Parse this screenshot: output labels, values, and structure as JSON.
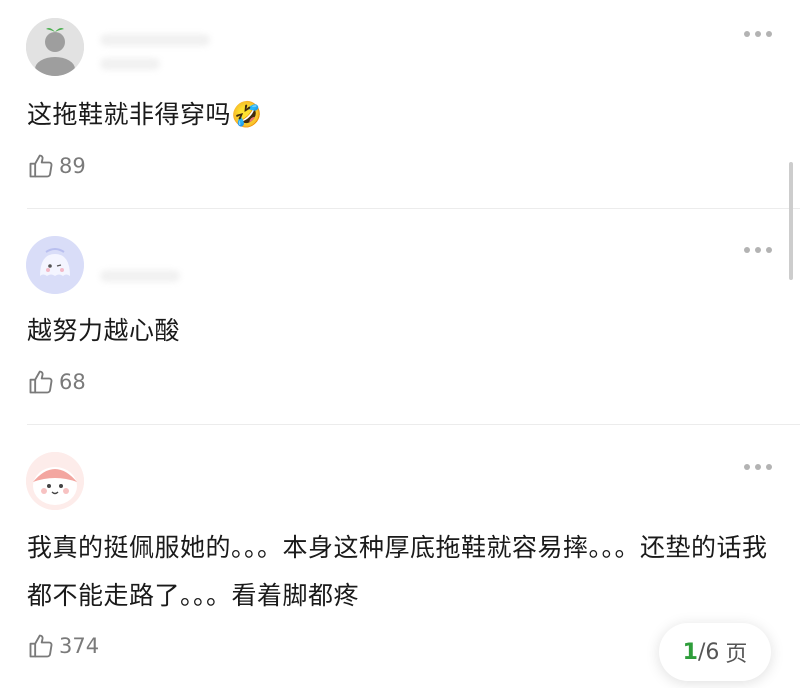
{
  "comments": [
    {
      "text": "这拖鞋就非得穿吗",
      "emoji": "🤣",
      "likes": "89"
    },
    {
      "text": "越努力越心酸",
      "likes": "68"
    },
    {
      "text": "我真的挺佩服她的。。。本身这种厚底拖鞋就容易摔。。。还垫的话我都不能走路了。。。看着脚都疼",
      "likes": "374"
    }
  ],
  "pager": {
    "current": "1",
    "total": "/6",
    "unit": "页"
  },
  "colors": {
    "accent": "#2e9d3a",
    "muted": "#7a7a7a",
    "divider": "#ececec"
  },
  "icons": {
    "like": "thumbs-up-icon",
    "more": "more-dots-icon"
  }
}
